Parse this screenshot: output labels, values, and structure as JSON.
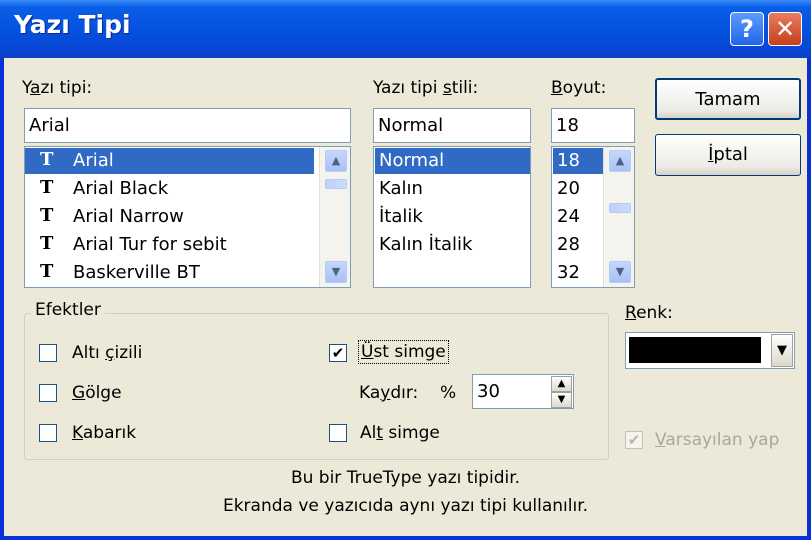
{
  "window": {
    "title": "Yazı Tipi",
    "help_glyph": "?",
    "close_glyph": "✕"
  },
  "font": {
    "label_pre": "Y",
    "label_ul": "a",
    "label_post": "zı tipi:",
    "value": "Arial",
    "items": [
      "Arial",
      "Arial Black",
      "Arial Narrow",
      "Arial Tur for sebit",
      "Baskerville BT"
    ],
    "selected_index": 0,
    "icon_glyph": "T"
  },
  "style": {
    "label_pre": "Yazı tipi ",
    "label_ul": "s",
    "label_post": "tili:",
    "value": "Normal",
    "items": [
      "Normal",
      "Kalın",
      "İtalik",
      "Kalın İtalik"
    ],
    "selected_index": 0
  },
  "size": {
    "label_pre": "",
    "label_ul": "B",
    "label_post": "oyut:",
    "value": "18",
    "items": [
      "18",
      "20",
      "24",
      "28",
      "32"
    ],
    "selected_index": 0
  },
  "buttons": {
    "ok": "Tamam",
    "cancel_ul": "İ",
    "cancel_post": "ptal"
  },
  "effects": {
    "legend": "Efektler",
    "underline_pre": "Altı ",
    "underline_ul": "ç",
    "underline_post": "izili",
    "underline_checked": false,
    "shadow_pre": "",
    "shadow_ul": "G",
    "shadow_post": "ölge",
    "shadow_checked": false,
    "emboss_pre": "",
    "emboss_ul": "K",
    "emboss_post": "abarık",
    "emboss_checked": false,
    "superscript_pre": "",
    "superscript_ul": "Ü",
    "superscript_post": "st simge",
    "superscript_checked": true,
    "offset_pre": "Ka",
    "offset_ul": "y",
    "offset_post": "dır:",
    "offset_pct": "%",
    "offset_value": "30",
    "subscript_pre": "Al",
    "subscript_ul": "t",
    "subscript_post": " simge",
    "subscript_checked": false
  },
  "color": {
    "label_pre": "",
    "label_ul": "R",
    "label_post": "enk:",
    "value": "#000000",
    "default_pre": "",
    "default_ul": "V",
    "default_post": "arsayılan yap",
    "default_checked": true,
    "default_disabled": true
  },
  "description": {
    "line1": "Bu bir TrueType yazı tipidir.",
    "line2": "Ekranda ve yazıcıda aynı yazı tipi kullanılır."
  },
  "glyphs": {
    "check": "✔",
    "up": "▲",
    "down": "▼"
  },
  "colors": {
    "selection": "#316ac5",
    "title_bar": "#0552e0",
    "face": "#ece9d8"
  }
}
